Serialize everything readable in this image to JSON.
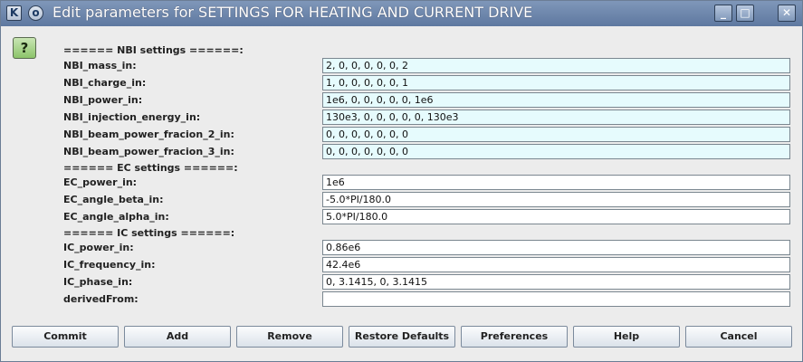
{
  "window": {
    "title": "Edit parameters for SETTINGS FOR HEATING AND CURRENT DRIVE",
    "app_icon_glyph": "K",
    "menu_icon_glyph": "o",
    "minimize_glyph": "_",
    "maximize_glyph": "□",
    "close_glyph": "✕"
  },
  "help_glyph": "?",
  "sections": {
    "nbi": "====== NBI settings ======:",
    "ec": "====== EC settings ======:",
    "ic": "====== IC settings ======:"
  },
  "params": [
    {
      "label": "NBI_mass_in:",
      "value": "2, 0, 0, 0, 0, 0, 2"
    },
    {
      "label": "NBI_charge_in:",
      "value": "1, 0, 0, 0, 0, 0, 1"
    },
    {
      "label": "NBI_power_in:",
      "value": "1e6, 0, 0, 0, 0, 0, 1e6"
    },
    {
      "label": "NBI_injection_energy_in:",
      "value": "130e3, 0, 0, 0, 0, 0, 130e3"
    },
    {
      "label": "NBI_beam_power_fracion_2_in:",
      "value": "0, 0, 0, 0, 0, 0, 0"
    },
    {
      "label": "NBI_beam_power_fracion_3_in:",
      "value": "0, 0, 0, 0, 0, 0, 0"
    },
    {
      "label": "EC_power_in:",
      "value": "1e6"
    },
    {
      "label": "EC_angle_beta_in:",
      "value": "-5.0*PI/180.0"
    },
    {
      "label": "EC_angle_alpha_in:",
      "value": "5.0*PI/180.0"
    },
    {
      "label": "IC_power_in:",
      "value": "0.86e6"
    },
    {
      "label": "IC_frequency_in:",
      "value": "42.4e6"
    },
    {
      "label": "IC_phase_in:",
      "value": "0, 3.1415, 0, 3.1415"
    },
    {
      "label": "derivedFrom:",
      "value": ""
    }
  ],
  "buttons": {
    "commit": "Commit",
    "add": "Add",
    "remove": "Remove",
    "restore": "Restore Defaults",
    "preferences": "Preferences",
    "help": "Help",
    "cancel": "Cancel"
  },
  "colors": {
    "titlebar": "#6c86ac",
    "field_vector_bg": "#e6fbfd",
    "field_scalar_bg": "#ffffff",
    "help_button": "#8cc46a"
  }
}
